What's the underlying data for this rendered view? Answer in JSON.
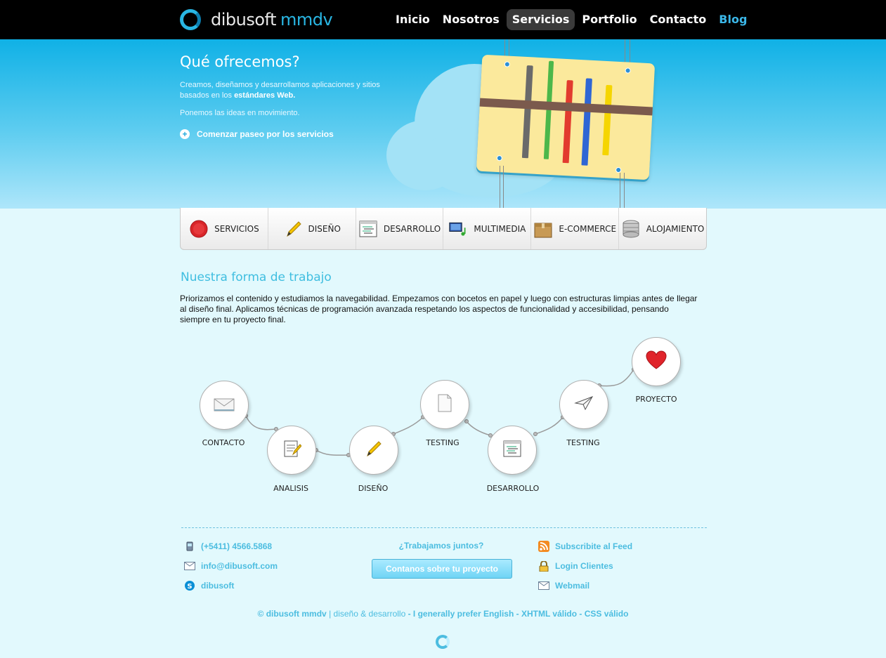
{
  "header": {
    "logo_main": "dibusoft",
    "logo_accent": "mmdv",
    "nav": [
      {
        "label": "Inicio"
      },
      {
        "label": "Nosotros"
      },
      {
        "label": "Servicios"
      },
      {
        "label": "Portfolio"
      },
      {
        "label": "Contacto"
      },
      {
        "label": "Blog"
      }
    ]
  },
  "hero": {
    "title": "Qué ofrecemos?",
    "p1_text": "Creamos, diseñamos y desarrollamos aplicaciones y sitios basados en los ",
    "p1_bold": "estándares Web.",
    "p2": "Ponemos las ideas en movimiento.",
    "tour_label": "Comenzar paseo por los servicios"
  },
  "tabs": [
    {
      "label": "SERVICIOS",
      "icon": "red-seal-icon"
    },
    {
      "label": "DISEÑO",
      "icon": "pencil-icon"
    },
    {
      "label": "DESARROLLO",
      "icon": "code-window-icon"
    },
    {
      "label": "MULTIMEDIA",
      "icon": "multimedia-icon"
    },
    {
      "label": "E-COMMERCE",
      "icon": "box-icon"
    },
    {
      "label": "ALOJAMIENTO",
      "icon": "database-icon"
    }
  ],
  "work": {
    "title": "Nuestra forma de trabajo",
    "text": "Priorizamos el contenido y estudiamos la navegabilidad. Empezamos con bocetos en papel y luego con estructuras limpias antes de llegar al diseño final. Aplicamos técnicas de programación avanzada respetando los aspectos de funcionalidad y accesibilidad, pensando siempre en tu proyecto final.",
    "steps": [
      {
        "label": "CONTACTO",
        "icon": "envelope-icon"
      },
      {
        "label": "ANALISIS",
        "icon": "notepad-icon"
      },
      {
        "label": "DISEÑO",
        "icon": "pencil-icon"
      },
      {
        "label": "TESTING",
        "icon": "document-icon"
      },
      {
        "label": "DESARROLLO",
        "icon": "code-window-icon"
      },
      {
        "label": "TESTING",
        "icon": "paper-plane-icon"
      },
      {
        "label": "PROYECTO",
        "icon": "heart-icon"
      }
    ]
  },
  "footer": {
    "phone": "(+5411) 4566.5868",
    "email": "info@dibusoft.com",
    "skype": "dibusoft",
    "cta_question": "¿Trabajamos juntos?",
    "cta_button": "Contanos sobre tu proyecto",
    "feed": "Subscribite al Feed",
    "login": "Login Clientes",
    "webmail": "Webmail",
    "copy_brand": "© dibusoft mmdv",
    "copy_sep1": " | diseño & desarrollo",
    "copy_lang": " - I generally prefer English",
    "copy_xhtml": " - XHTML válido",
    "copy_css": " - CSS válido"
  },
  "colors": {
    "accent": "#4cbde0",
    "brand_blue": "#29b6e3",
    "header_bg": "#000000",
    "page_bg": "#e2f9fd"
  }
}
